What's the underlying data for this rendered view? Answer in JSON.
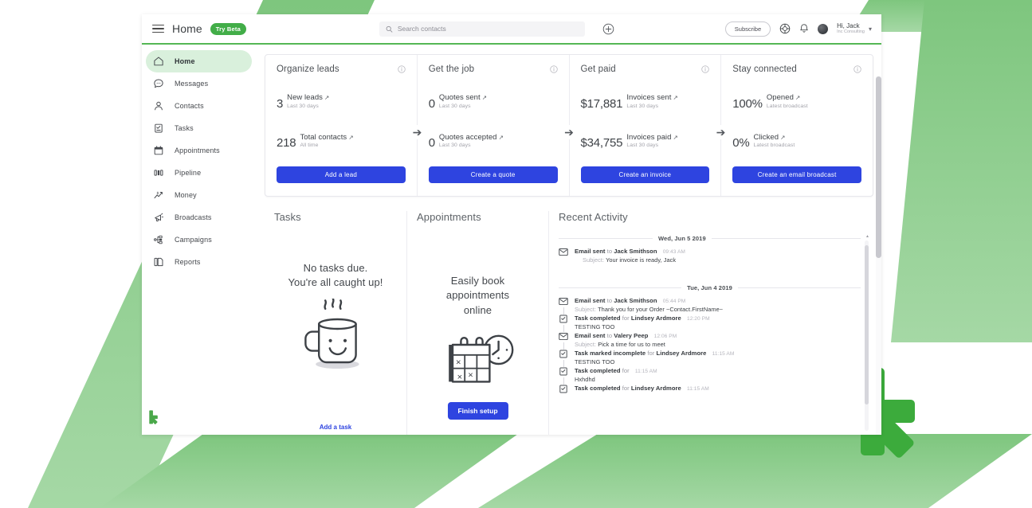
{
  "brand": {
    "green": "#42ad48",
    "light_green": "#8dcd8d",
    "blue": "#2e44e0",
    "logo_name": "keap-logo"
  },
  "topbar": {
    "menu_icon": "hamburger-icon",
    "title": "Home",
    "beta_badge": "Try Beta",
    "search": {
      "placeholder": "Search contacts",
      "value": "",
      "icon": "search-icon"
    },
    "add_icon": "plus-circle-icon",
    "subscribe_label": "Subscribe",
    "help_icon": "lifebuoy-icon",
    "bell_icon": "bell-icon",
    "avatar": "user-avatar",
    "user_greeting": "Hi, Jack",
    "user_org": "Inc Consulting",
    "chevron": "chevron-down-icon"
  },
  "sidebar": {
    "items": [
      {
        "label": "Home",
        "icon": "home-icon",
        "active": true
      },
      {
        "label": "Messages",
        "icon": "message-icon",
        "active": false
      },
      {
        "label": "Contacts",
        "icon": "person-icon",
        "active": false
      },
      {
        "label": "Tasks",
        "icon": "clipboard-check-icon",
        "active": false
      },
      {
        "label": "Appointments",
        "icon": "calendar-icon",
        "active": false
      },
      {
        "label": "Pipeline",
        "icon": "pipeline-icon",
        "active": false
      },
      {
        "label": "Money",
        "icon": "money-chart-icon",
        "active": false
      },
      {
        "label": "Broadcasts",
        "icon": "megaphone-icon",
        "active": false
      },
      {
        "label": "Campaigns",
        "icon": "campaign-nodes-icon",
        "active": false
      },
      {
        "label": "Reports",
        "icon": "report-doc-icon",
        "active": false
      }
    ]
  },
  "kpi_cards": [
    {
      "title": "Organize leads",
      "info_icon": "info-icon",
      "metrics": [
        {
          "value": "3",
          "label": "New leads",
          "sub": "Last 30 days"
        },
        {
          "value": "218",
          "label": "Total contacts",
          "sub": "All time"
        }
      ],
      "button": "Add a lead"
    },
    {
      "title": "Get the job",
      "info_icon": "info-icon",
      "metrics": [
        {
          "value": "0",
          "label": "Quotes sent",
          "sub": "Last 30 days"
        },
        {
          "value": "0",
          "label": "Quotes accepted",
          "sub": "Last 30 days"
        }
      ],
      "button": "Create a quote"
    },
    {
      "title": "Get paid",
      "info_icon": "info-icon",
      "metrics": [
        {
          "value": "$17,881",
          "label": "Invoices sent",
          "sub": "Last 30 days"
        },
        {
          "value": "$34,755",
          "label": "Invoices paid",
          "sub": "Last 30 days"
        }
      ],
      "button": "Create an invoice"
    },
    {
      "title": "Stay connected",
      "info_icon": "info-icon",
      "metrics": [
        {
          "value": "100%",
          "label": "Opened",
          "sub": "Latest broadcast"
        },
        {
          "value": "0%",
          "label": "Clicked",
          "sub": "Latest broadcast"
        }
      ],
      "button": "Create an email broadcast"
    }
  ],
  "tasks_panel": {
    "title": "Tasks",
    "empty_message": "No tasks due.\nYou're all caught up!",
    "illustration": "coffee-mug-icon",
    "add_link": "Add a task"
  },
  "appointments_panel": {
    "title": "Appointments",
    "empty_message": "Easily book appointments online",
    "illustration": "calendar-clock-icon",
    "button": "Finish setup"
  },
  "activity_panel": {
    "title": "Recent Activity",
    "groups": [
      {
        "date": "Wed, Jun 5 2019",
        "entries": [
          {
            "icon": "envelope-icon",
            "action": "Email sent",
            "connector": "to",
            "who": "Jack Smithson",
            "time": "09:43 AM",
            "detail_key": "Subject:",
            "detail": "Your invoice is ready, Jack"
          }
        ]
      },
      {
        "date": "Tue, Jun 4 2019",
        "entries": [
          {
            "icon": "envelope-icon",
            "action": "Email sent",
            "connector": "to",
            "who": "Jack Smithson",
            "time": "05:44 PM",
            "detail_key": "Subject:",
            "detail": "Thank you for your Order ~Contact.FirstName~"
          },
          {
            "icon": "task-icon",
            "action": "Task completed",
            "connector": "for",
            "who": "Lindsey Ardmore",
            "time": "12:20 PM",
            "detail_key": "",
            "detail": "TESTING TOO"
          },
          {
            "icon": "envelope-icon",
            "action": "Email sent",
            "connector": "to",
            "who": "Valery Peep",
            "time": "12:06 PM",
            "detail_key": "Subject:",
            "detail": "Pick a time for us to meet"
          },
          {
            "icon": "task-icon",
            "action": "Task marked incomplete",
            "connector": "for",
            "who": "Lindsey Ardmore",
            "time": "11:15 AM",
            "detail_key": "",
            "detail": "TESTING TOO"
          },
          {
            "icon": "task-icon",
            "action": "Task completed",
            "connector": "for",
            "who": "",
            "time": "11:15 AM",
            "detail_key": "",
            "detail": "Hxhdhd"
          },
          {
            "icon": "task-icon",
            "action": "Task completed",
            "connector": "for",
            "who": "Lindsey Ardmore",
            "time": "11:15 AM",
            "detail_key": "",
            "detail": ""
          }
        ]
      }
    ]
  }
}
